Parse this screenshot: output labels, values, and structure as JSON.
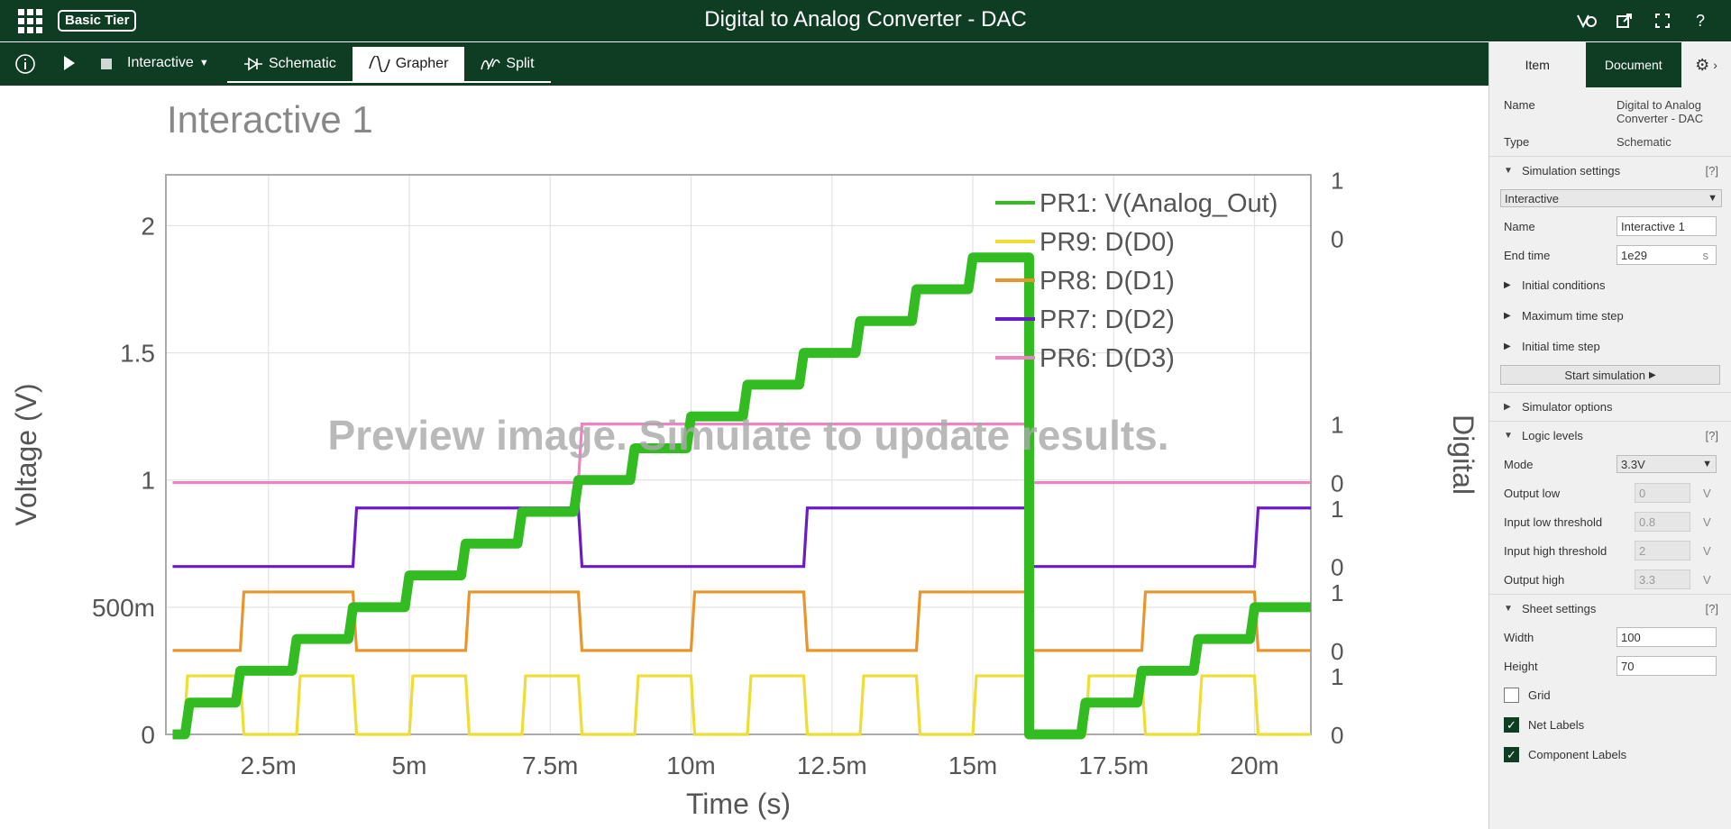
{
  "header": {
    "title": "Digital to Analog Converter - DAC",
    "tier_badge": "Basic Tier",
    "icons": [
      "apps-grid-icon",
      "simulation-icon",
      "open-external-icon",
      "fullscreen-icon",
      "help-icon"
    ],
    "help_label": "?"
  },
  "toolbar": {
    "mode_label": "Interactive",
    "tabs": [
      {
        "label": "Schematic",
        "icon": "schematic-icon"
      },
      {
        "label": "Grapher",
        "icon": "waveform-icon",
        "active": true
      },
      {
        "label": "Split",
        "icon": "split-icon"
      }
    ]
  },
  "chart_title": "Interactive 1",
  "watermark": "Preview image. Simulate to update results.",
  "chart_data": {
    "type": "line",
    "xlabel": "Time (s)",
    "ylabel": "Voltage (V)",
    "y2label": "Digital",
    "xlim": [
      0.00068,
      0.021
    ],
    "ylim": [
      0,
      2.2
    ],
    "x_ticks": [
      {
        "v": 0.0025,
        "label": "2.5m"
      },
      {
        "v": 0.005,
        "label": "5m"
      },
      {
        "v": 0.0075,
        "label": "7.5m"
      },
      {
        "v": 0.01,
        "label": "10m"
      },
      {
        "v": 0.0125,
        "label": "12.5m"
      },
      {
        "v": 0.015,
        "label": "15m"
      },
      {
        "v": 0.0175,
        "label": "17.5m"
      },
      {
        "v": 0.02,
        "label": "20m"
      }
    ],
    "y_ticks": [
      {
        "v": 0,
        "label": "0"
      },
      {
        "v": 0.5,
        "label": "500m"
      },
      {
        "v": 1,
        "label": "1"
      },
      {
        "v": 1.5,
        "label": "1.5"
      },
      {
        "v": 2,
        "label": "2"
      }
    ],
    "digital_levels": [
      {
        "low": 0,
        "high": 0.23
      },
      {
        "low": 0.33,
        "high": 0.56
      },
      {
        "low": 0.66,
        "high": 0.89
      },
      {
        "low": 0.99,
        "high": 1.22
      },
      {
        "low": 1.95,
        "high": 2.18
      }
    ],
    "right_tick_labels": [
      "0",
      "1"
    ],
    "legend_position": "top-right",
    "series": [
      {
        "name": "PR1: V(Analog_Out)",
        "color": "#33bb22",
        "kind": "analog",
        "x": [
          0.0008,
          0.0011,
          0.002,
          0.003,
          0.004,
          0.005,
          0.006,
          0.007,
          0.008,
          0.009,
          0.01,
          0.011,
          0.012,
          0.013,
          0.014,
          0.015,
          0.016,
          0.016,
          0.017,
          0.018,
          0.019,
          0.02,
          0.021
        ],
        "y": [
          0,
          0.125,
          0.25,
          0.375,
          0.5,
          0.625,
          0.75,
          0.875,
          1.0,
          1.125,
          1.25,
          1.375,
          1.5,
          1.625,
          1.75,
          1.875,
          1.875,
          0,
          0.125,
          0.25,
          0.375,
          0.5,
          0.5
        ]
      },
      {
        "name": "PR9: D(D0)",
        "color": "#eedd33",
        "kind": "digital",
        "level": 0,
        "period": 0.002,
        "phase": 0.001,
        "start": 0.0008
      },
      {
        "name": "PR8: D(D1)",
        "color": "#e8952b",
        "kind": "digital",
        "level": 1,
        "period": 0.004,
        "phase": 0.002,
        "start": 0.0008
      },
      {
        "name": "PR7: D(D2)",
        "color": "#6a1bc7",
        "kind": "digital",
        "level": 2,
        "period": 0.008,
        "phase": 0.004,
        "start": 0.0008
      },
      {
        "name": "PR6: D(D3)",
        "color": "#ee82c2",
        "kind": "digital",
        "level": 3,
        "period": 0.016,
        "phase": 0.008,
        "start": 0.0008
      }
    ],
    "grid": true
  },
  "panel": {
    "tabs": [
      "Item",
      "Document"
    ],
    "name_label": "Name",
    "name_value": "Digital to Analog Converter - DAC",
    "type_label": "Type",
    "type_value": "Schematic",
    "sim_settings": "Simulation settings",
    "help": "[?]",
    "sim_mode": "Interactive",
    "sim_name_label": "Name",
    "sim_name_value": "Interactive 1",
    "end_time_label": "End time",
    "end_time_value": "1e29",
    "end_time_unit": "s",
    "initial_conditions": "Initial conditions",
    "max_time_step": "Maximum time step",
    "initial_time_step": "Initial time step",
    "start_simulation": "Start simulation",
    "simulator_options": "Simulator options",
    "logic_levels": "Logic levels",
    "mode_label": "Mode",
    "mode_value": "3.3V",
    "output_low_label": "Output low",
    "output_low_value": "0",
    "input_low_label": "Input low threshold",
    "input_low_value": "0.8",
    "input_high_label": "Input high threshold",
    "input_high_value": "2",
    "output_high_label": "Output high",
    "output_high_value": "3.3",
    "unit_v": "V",
    "sheet_settings": "Sheet settings",
    "width_label": "Width",
    "width_value": "100",
    "height_label": "Height",
    "height_value": "70",
    "grid_label": "Grid",
    "net_labels_label": "Net Labels",
    "component_labels_label": "Component Labels"
  }
}
